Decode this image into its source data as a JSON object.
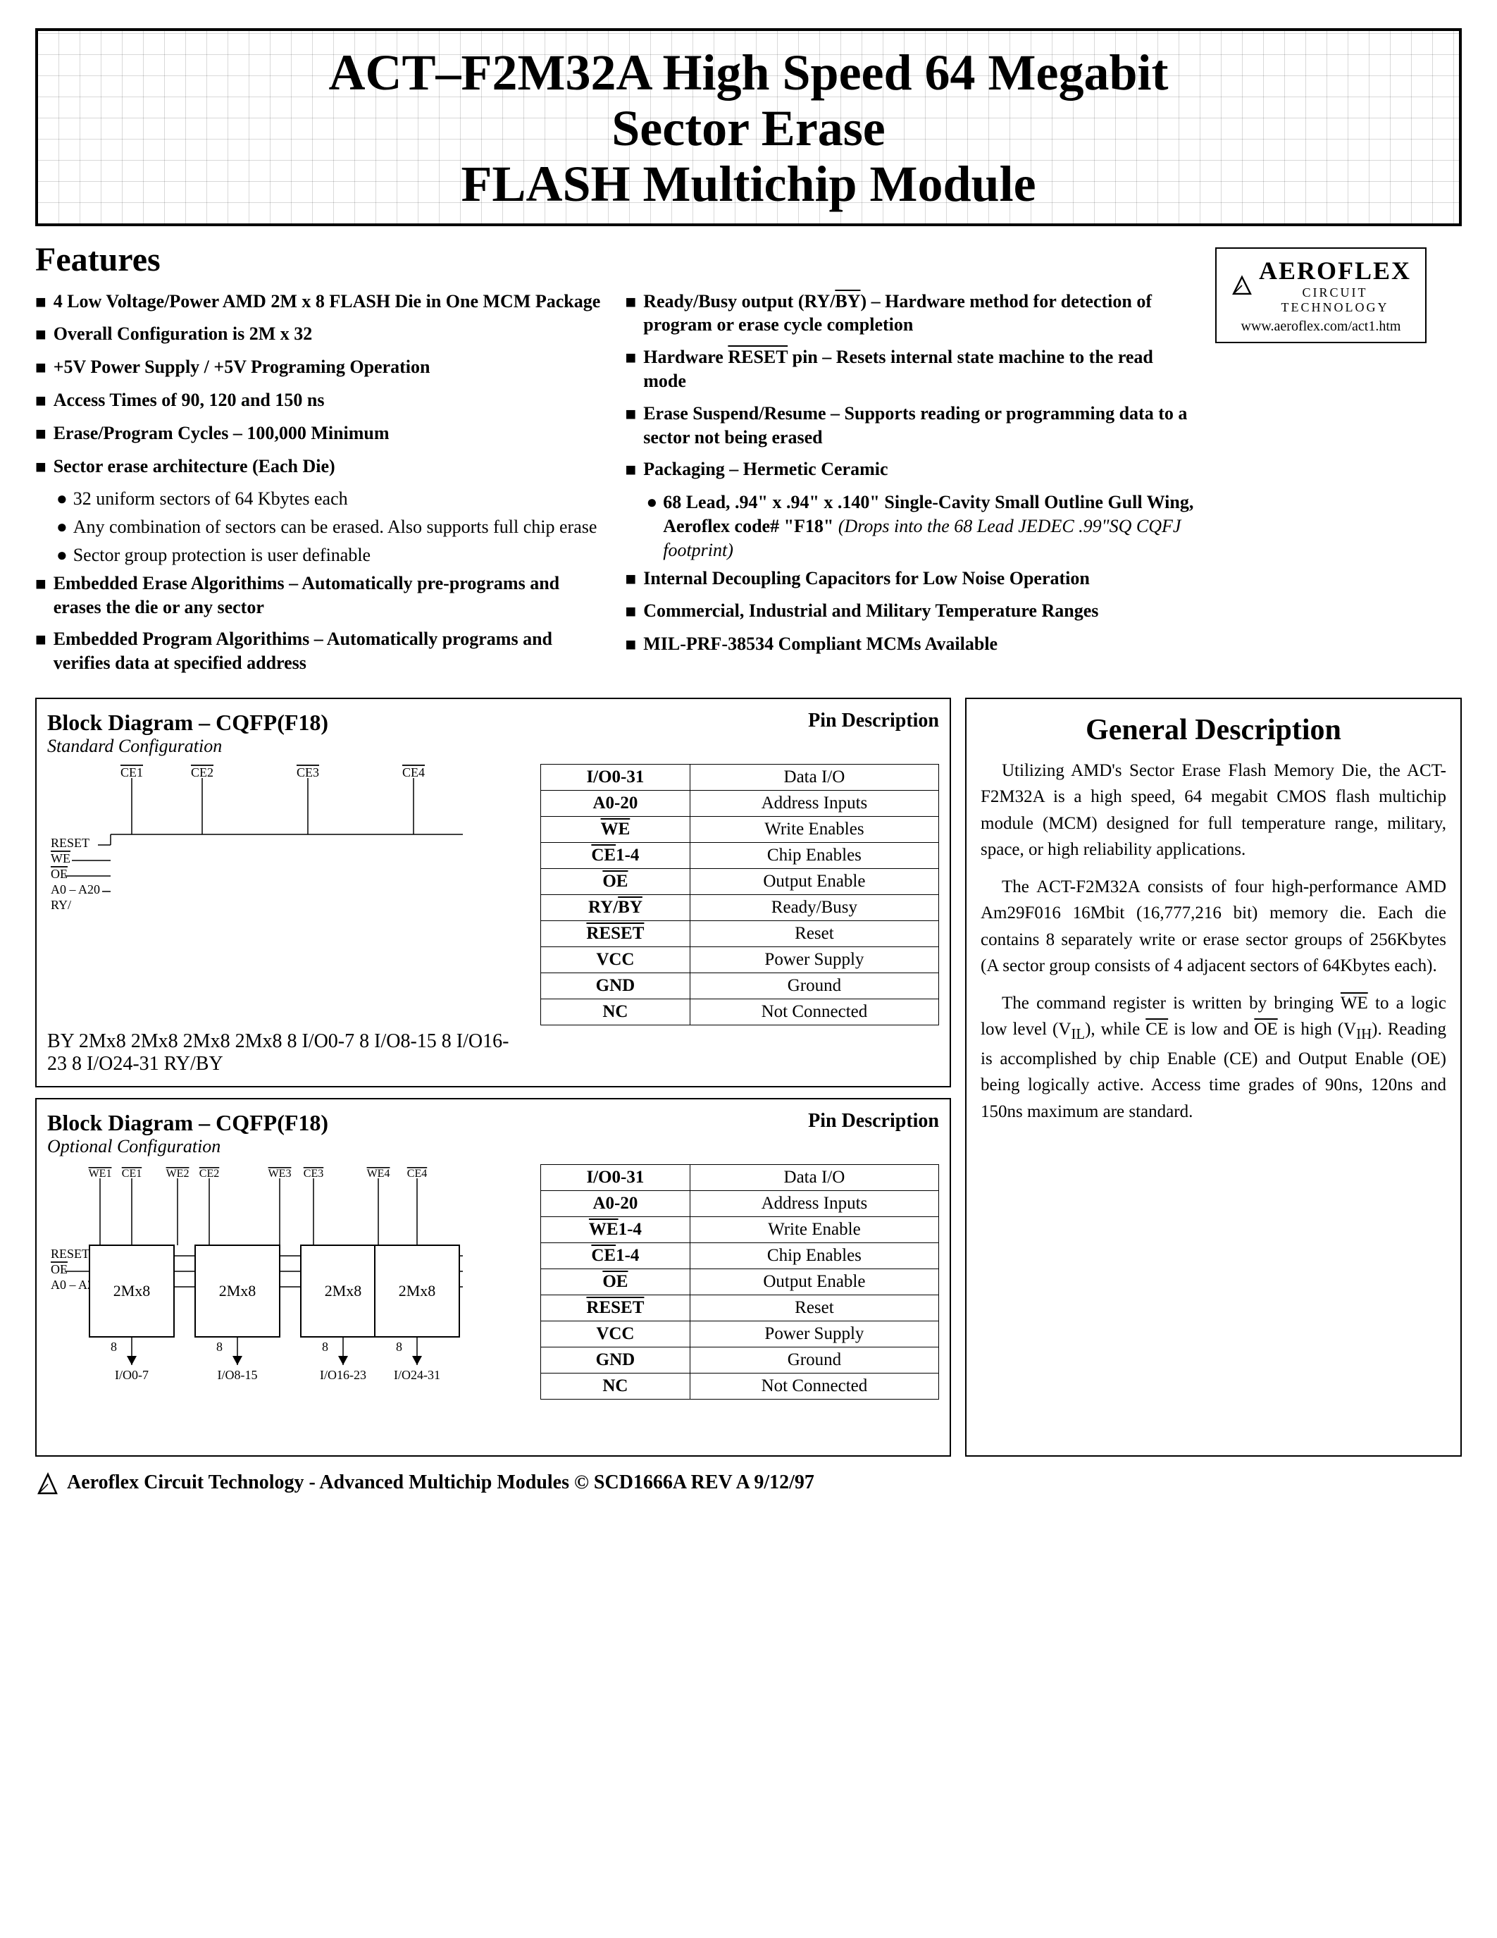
{
  "title": {
    "line1": "ACT–F2M32A High Speed 64 Megabit",
    "line2": "Sector Erase",
    "line3": "FLASH Multichip Module"
  },
  "logo": {
    "brand": "AEROFLEX",
    "subtitle": "CIRCUIT TECHNOLOGY",
    "url": "www.aeroflex.com/act1.htm"
  },
  "features": {
    "heading": "Features",
    "left_col": [
      {
        "text": "4 Low Voltage/Power AMD 2M x 8 FLASH Die in One MCM Package",
        "bold": true
      },
      {
        "text": "Overall Configuration is 2M x 32",
        "bold": true
      },
      {
        "text": "+5V Power Supply / +5V Programing Operation",
        "bold": true
      },
      {
        "text": "Access Times of 90, 120 and 150 ns",
        "bold": true
      },
      {
        "text": "Erase/Program Cycles – 100,000 Minimum",
        "bold": true
      },
      {
        "text": "Sector erase architecture (Each Die)",
        "bold": true
      },
      {
        "text_sub": [
          "32 uniform sectors of 64 Kbytes each",
          "Any combination of sectors can be erased. Also supports full chip erase",
          "Sector group protection is user definable"
        ]
      },
      {
        "text": "Embedded Erase Algorithims – Automatically pre-programs and erases the die or any sector",
        "bold": true
      },
      {
        "text": "Embedded Program Algorithims – Automatically programs and verifies data at specified address",
        "bold": true
      }
    ],
    "right_col": [
      {
        "text": "Ready/Busy output (RY/BY) – Hardware method for detection of program or erase cycle completion",
        "bold": true
      },
      {
        "text": "Hardware RESET pin – Resets internal state machine to the read mode",
        "bold": true
      },
      {
        "text": "Erase Suspend/Resume – Supports reading or programming data to a sector not being erased",
        "bold": true
      },
      {
        "text": "Packaging – Hermetic Ceramic",
        "bold": true
      },
      {
        "text_sub_detail": [
          "68 Lead, .94\" x .94\" x .140\" Single-Cavity Small Outline Gull Wing, Aeroflex code# \"F18\" (Drops into the 68 Lead JEDEC .99\"SQ CQFJ footprint)"
        ]
      },
      {
        "text": "Internal Decoupling Capacitors for Low Noise Operation",
        "bold": true
      },
      {
        "text": "Commercial, Industrial and Military Temperature Ranges",
        "bold": true
      },
      {
        "text": "MIL-PRF-38534 Compliant MCMs Available",
        "bold": true
      }
    ]
  },
  "block_diagram_1": {
    "title": "Block Diagram – CQFP(F18)",
    "subtitle": "Standard Configuration",
    "pin_desc_title": "Pin Description",
    "pins": [
      {
        "pin": "I/O0-31",
        "desc": "Data I/O"
      },
      {
        "pin": "A0-20",
        "desc": "Address Inputs"
      },
      {
        "pin": "WE",
        "desc": "Write Enables",
        "overline": true
      },
      {
        "pin": "CE1-4",
        "desc": "Chip Enables",
        "overline": true
      },
      {
        "pin": "OE",
        "desc": "Output Enable",
        "overline": true
      },
      {
        "pin": "RY/BY",
        "desc": "Ready/Busy",
        "overline": true
      },
      {
        "pin": "RESET",
        "desc": "Reset",
        "overline": true
      },
      {
        "pin": "VCC",
        "desc": "Power Supply"
      },
      {
        "pin": "GND",
        "desc": "Ground"
      },
      {
        "pin": "NC",
        "desc": "Not Connected"
      }
    ]
  },
  "block_diagram_2": {
    "title": "Block Diagram – CQFP(F18)",
    "subtitle": "Optional Configuration",
    "pin_desc_title": "Pin Description",
    "pins": [
      {
        "pin": "I/O0-31",
        "desc": "Data I/O"
      },
      {
        "pin": "A0-20",
        "desc": "Address Inputs"
      },
      {
        "pin": "WE1-4",
        "desc": "Write Enable",
        "overline": true
      },
      {
        "pin": "CE1-4",
        "desc": "Chip Enables",
        "overline": true
      },
      {
        "pin": "OE",
        "desc": "Output Enable",
        "overline": true
      },
      {
        "pin": "RESET",
        "desc": "Reset",
        "overline": true
      },
      {
        "pin": "VCC",
        "desc": "Power Supply"
      },
      {
        "pin": "GND",
        "desc": "Ground"
      },
      {
        "pin": "NC",
        "desc": "Not Connected"
      }
    ]
  },
  "general_description": {
    "title": "General Description",
    "para1": "Utilizing AMD's Sector Erase Flash Memory Die, the ACT-F2M32A is a high speed, 64 megabit CMOS flash multichip module (MCM) designed for full temperature range, military, space, or high reliability applications.",
    "para2": "The ACT-F2M32A consists of four high-performance AMD Am29F016 16Mbit (16,777,216 bit) memory die. Each die contains 8 separately write or erase sector groups of 256Kbytes (A sector group consists of 4 adjacent sectors of 64Kbytes each).",
    "para3": "The command register is written by bringing WE to a logic low level (VIL), while CE is low and OE is high (VIH). Reading is accomplished by chip Enable (CE) and Output Enable (OE) being logically active. Access time grades of 90ns, 120ns and 150ns maximum are standard."
  },
  "footer": {
    "text": "Aeroflex Circuit Technology - Advanced Multichip Modules © SCD1666A REV A  9/12/97"
  }
}
